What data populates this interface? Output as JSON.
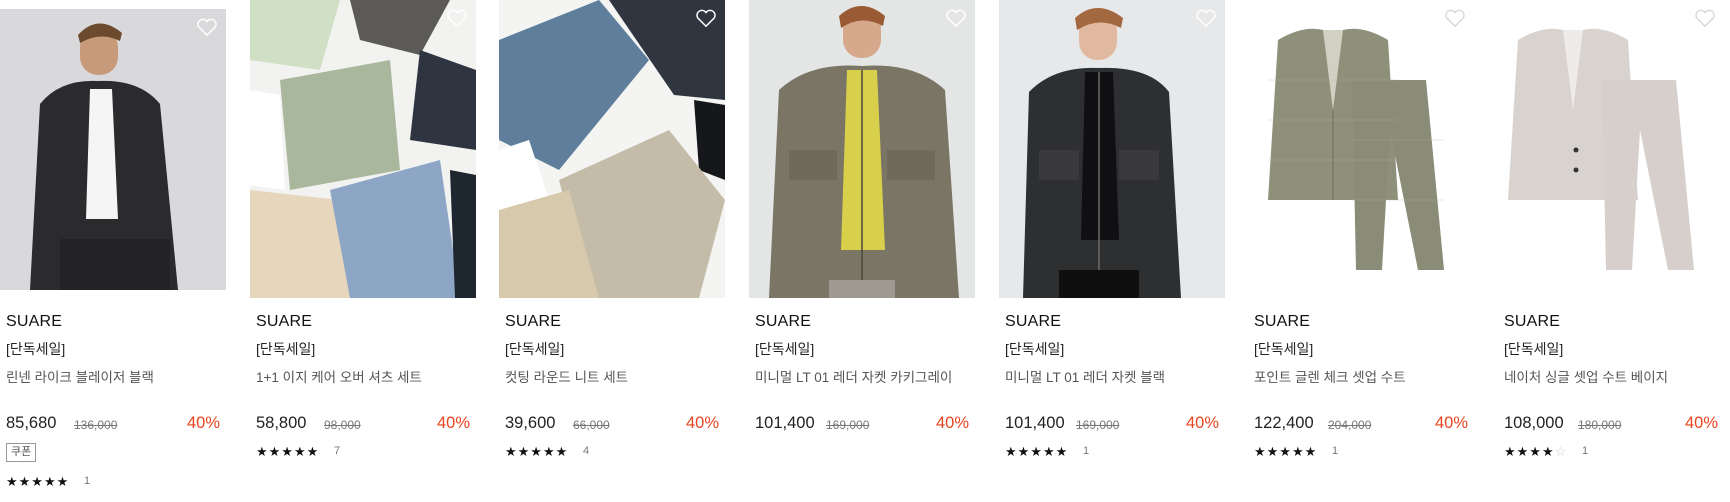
{
  "colors": {
    "accent": "#e8441f",
    "text": "#222222",
    "muted": "#777777"
  },
  "products": [
    {
      "brand": "SUARE",
      "tag": "[단독세일]",
      "name": "린넨 라이크 블레이저 블랙",
      "price": "85,680",
      "original_price": "136,000",
      "discount": "40%",
      "coupon": "쿠폰",
      "rating": 5,
      "reviews": "1",
      "image": "model-black-blazer"
    },
    {
      "brand": "SUARE",
      "tag": "[단독세일]",
      "name": "1+1 이지 케어 오버 셔츠 세트",
      "price": "58,800",
      "original_price": "98,000",
      "discount": "40%",
      "rating": 5,
      "reviews": "7",
      "image": "folded-shirts"
    },
    {
      "brand": "SUARE",
      "tag": "[단독세일]",
      "name": "컷팅 라운드 니트 세트",
      "price": "39,600",
      "original_price": "66,000",
      "discount": "40%",
      "rating": 5,
      "reviews": "4",
      "image": "folded-knits"
    },
    {
      "brand": "SUARE",
      "tag": "[단독세일]",
      "name": "미니멀 LT 01 레더 자켓 카키그레이",
      "price": "101,400",
      "original_price": "169,000",
      "discount": "40%",
      "rating": 5,
      "reviews": "",
      "image": "model-khaki-leather-jacket"
    },
    {
      "brand": "SUARE",
      "tag": "[단독세일]",
      "name": "미니멀 LT 01 레더 자켓 블랙",
      "price": "101,400",
      "original_price": "169,000",
      "discount": "40%",
      "rating": 5,
      "reviews": "1",
      "image": "model-black-leather-jacket"
    },
    {
      "brand": "SUARE",
      "tag": "[단독세일]",
      "name": "포인트 글렌 체크 셋업 수트",
      "price": "122,400",
      "original_price": "204,000",
      "discount": "40%",
      "rating": 5,
      "reviews": "1",
      "image": "glen-check-suit"
    },
    {
      "brand": "SUARE",
      "tag": "[단독세일]",
      "name": "네이처 싱글 셋업 수트 베이지",
      "price": "108,000",
      "original_price": "180,000",
      "discount": "40%",
      "rating": 4,
      "reviews": "1",
      "image": "beige-suit"
    }
  ]
}
